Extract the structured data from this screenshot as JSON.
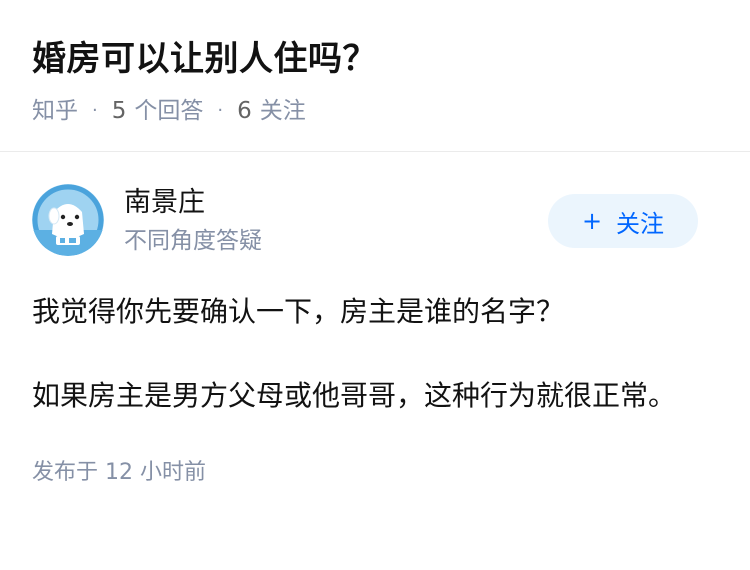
{
  "question": {
    "title": "婚房可以让别人住吗？",
    "source": "知乎",
    "separator": "·",
    "answers_count": "5",
    "answers_label": "个回答",
    "followers_count": "6",
    "followers_label": "关注"
  },
  "answer": {
    "author": {
      "name": "南景庄",
      "headline": "不同角度答疑",
      "avatar_icon": "cartoon-dog-avatar-icon"
    },
    "follow_button": {
      "plus": "+",
      "label": "关注"
    },
    "paragraphs": [
      "我觉得你先要确认一下，房主是谁的名字？",
      "如果房主是男方父母或他哥哥，这种行为就很正常。"
    ],
    "time_text": "发布于 12 小时前"
  },
  "colors": {
    "accent": "#0066ff",
    "follow_bg": "#ebf5fd",
    "meta_gray": "#8590a6",
    "text": "#121212"
  }
}
